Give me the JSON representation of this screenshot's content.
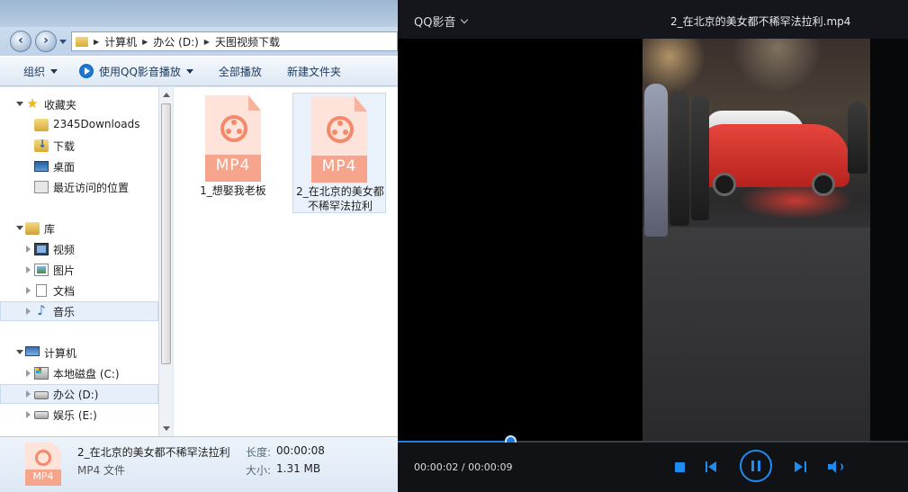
{
  "explorer": {
    "address": [
      "计算机",
      "办公 (D:)",
      "天图视频下载"
    ],
    "toolbar": {
      "organize": "组织",
      "open_with": "使用QQ影音播放",
      "play_all": "全部播放",
      "new_folder": "新建文件夹"
    },
    "nav": {
      "favorites": "收藏夹",
      "fav_items": [
        "2345Downloads",
        "下载",
        "桌面",
        "最近访问的位置"
      ],
      "libraries": "库",
      "lib_items": [
        "视频",
        "图片",
        "文档",
        "音乐"
      ],
      "computer": "计算机",
      "drives": [
        "本地磁盘 (C:)",
        "办公 (D:)",
        "娱乐 (E:)"
      ]
    },
    "files": [
      {
        "name": "1_想娶我老板",
        "icon_label": "MP4"
      },
      {
        "name": "2_在北京的美女都不稀罕法拉利",
        "icon_label": "MP4"
      }
    ],
    "details": {
      "name": "2_在北京的美女都不稀罕法拉利",
      "type": "MP4 文件",
      "duration_label": "长度:",
      "duration": "00:00:08",
      "size_label": "大小:",
      "size": "1.31 MB",
      "icon_label": "MP4"
    }
  },
  "player": {
    "app_name": "QQ影音",
    "file_title": "2_在北京的美女都不稀罕法拉利.mp4",
    "time": "00:00:02 / 00:00:09",
    "progress_fraction": 0.22,
    "accent_color": "#1e8cf0",
    "buttons": [
      "stop-icon",
      "prev-icon",
      "pause-icon",
      "next-icon",
      "volume-icon"
    ]
  }
}
